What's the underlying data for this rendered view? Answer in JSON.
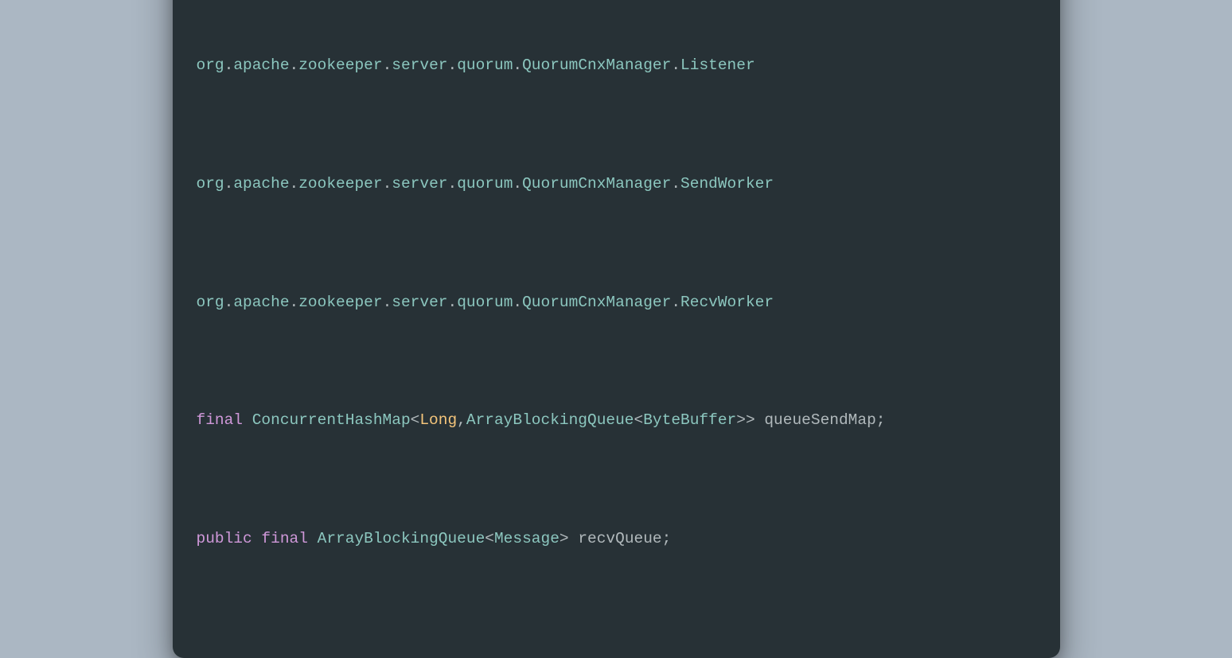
{
  "code": {
    "line1": {
      "seg1": "org",
      "d1": ".",
      "seg2": "apache",
      "d2": ".",
      "seg3": "zookeeper",
      "d3": ".",
      "seg4": "server",
      "d4": ".",
      "seg5": "quorum",
      "d5": ".",
      "seg6": "QuorumCnxManager",
      "d6": ".",
      "seg7": "Listener"
    },
    "line2": {
      "seg1": "org",
      "d1": ".",
      "seg2": "apache",
      "d2": ".",
      "seg3": "zookeeper",
      "d3": ".",
      "seg4": "server",
      "d4": ".",
      "seg5": "quorum",
      "d5": ".",
      "seg6": "QuorumCnxManager",
      "d6": ".",
      "seg7": "SendWorker"
    },
    "line3": {
      "seg1": "org",
      "d1": ".",
      "seg2": "apache",
      "d2": ".",
      "seg3": "zookeeper",
      "d3": ".",
      "seg4": "server",
      "d4": ".",
      "seg5": "quorum",
      "d5": ".",
      "seg6": "QuorumCnxManager",
      "d6": ".",
      "seg7": "RecvWorker"
    },
    "line4": {
      "kw": "final",
      "sp1": " ",
      "t1": "ConcurrentHashMap",
      "lt1": "<",
      "t2": "Long",
      "com": ",",
      "t3": "ArrayBlockingQueue",
      "lt2": "<",
      "t4": "ByteBuffer",
      "gt2": ">>",
      "sp2": " ",
      "var": "queueSendMap",
      "semi": ";"
    },
    "line5": {
      "kw1": "public",
      "sp1": " ",
      "kw2": "final",
      "sp2": " ",
      "t1": "ArrayBlockingQueue",
      "lt1": "<",
      "t2": "Message",
      "gt1": ">",
      "sp3": " ",
      "var": "recvQueue",
      "semi": ";"
    }
  }
}
